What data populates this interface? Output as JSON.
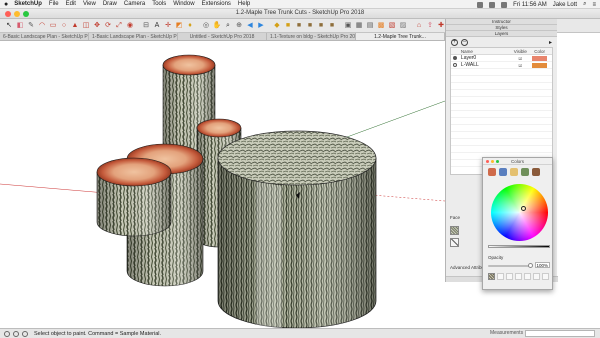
{
  "menubar": {
    "apple": "",
    "app_name": "SketchUp",
    "items": [
      "File",
      "Edit",
      "View",
      "Draw",
      "Camera",
      "Tools",
      "Window",
      "Extensions",
      "Help"
    ],
    "clock": "Fri 11:56 AM",
    "user": "Jake Lott"
  },
  "window": {
    "title": "1.2-Maple Tree Trunk Cuts - SketchUp Pro 2018",
    "traffic_lights": [
      "#ff5f57",
      "#febc2e",
      "#28c840"
    ]
  },
  "toolbar": {
    "icons": [
      {
        "name": "select-tool-icon",
        "glyph": "↖",
        "color": "#333333"
      },
      {
        "name": "eraser-tool-icon",
        "glyph": "◧",
        "color": "#d65b6e"
      },
      {
        "name": "line-tool-icon",
        "glyph": "✎",
        "color": "#555555"
      },
      {
        "name": "arc-tool-icon",
        "glyph": "◠",
        "color": "#c0392b"
      },
      {
        "name": "rectangle-tool-icon",
        "glyph": "▭",
        "color": "#c0392b"
      },
      {
        "name": "circle-tool-icon",
        "glyph": "○",
        "color": "#c0392b"
      },
      {
        "name": "push-pull-tool-icon",
        "glyph": "▲",
        "color": "#c0392b"
      },
      {
        "name": "offset-tool-icon",
        "glyph": "◫",
        "color": "#c0392b"
      },
      {
        "name": "move-tool-icon",
        "glyph": "✥",
        "color": "#c0392b"
      },
      {
        "name": "rotate-tool-icon",
        "glyph": "⟳",
        "color": "#c0392b"
      },
      {
        "name": "scale-tool-icon",
        "glyph": "⤢",
        "color": "#c0392b"
      },
      {
        "name": "follow-me-tool-icon",
        "glyph": "◉",
        "color": "#c0392b"
      },
      {
        "name": "tape-measure-tool-icon",
        "glyph": "⊟",
        "color": "#555555"
      },
      {
        "name": "text-tool-icon",
        "glyph": "A",
        "color": "#333333"
      },
      {
        "name": "axes-tool-icon",
        "glyph": "✛",
        "color": "#c0392b"
      },
      {
        "name": "section-plane-tool-icon",
        "glyph": "◩",
        "color": "#e67e22"
      },
      {
        "name": "paint-bucket-tool-icon",
        "glyph": "♦",
        "color": "#d4a017"
      },
      {
        "name": "orbit-tool-icon",
        "glyph": "◎",
        "color": "#555555"
      },
      {
        "name": "pan-tool-icon",
        "glyph": "✋",
        "color": "#555555"
      },
      {
        "name": "zoom-tool-icon",
        "glyph": "⌕",
        "color": "#333333"
      },
      {
        "name": "zoom-extents-icon",
        "glyph": "⊕",
        "color": "#555555"
      },
      {
        "name": "previous-view-icon",
        "glyph": "◀",
        "color": "#2e86de"
      },
      {
        "name": "next-view-icon",
        "glyph": "▶",
        "color": "#2e86de"
      },
      {
        "name": "iso-view-icon",
        "glyph": "◆",
        "color": "#d4a017"
      },
      {
        "name": "top-view-icon",
        "glyph": "■",
        "color": "#d4a017"
      },
      {
        "name": "front-view-icon",
        "glyph": "■",
        "color": "#8e6e3b"
      },
      {
        "name": "right-view-icon",
        "glyph": "■",
        "color": "#8e6e3b"
      },
      {
        "name": "back-view-icon",
        "glyph": "■",
        "color": "#8e6e3b"
      },
      {
        "name": "left-view-icon",
        "glyph": "■",
        "color": "#8e6e3b"
      },
      {
        "name": "xray-icon",
        "glyph": "▣",
        "color": "#555555"
      },
      {
        "name": "wireframe-icon",
        "glyph": "▦",
        "color": "#555555"
      },
      {
        "name": "hidden-line-icon",
        "glyph": "▤",
        "color": "#555555"
      },
      {
        "name": "shaded-icon",
        "glyph": "▩",
        "color": "#e67e22"
      },
      {
        "name": "shaded-textures-icon",
        "glyph": "▧",
        "color": "#c0392b"
      },
      {
        "name": "monochrome-icon",
        "glyph": "▨",
        "color": "#777777"
      },
      {
        "name": "warehouse-icon",
        "glyph": "⌂",
        "color": "#c0392b"
      },
      {
        "name": "share-model-icon",
        "glyph": "⇪",
        "color": "#d65b6e"
      },
      {
        "name": "extension-warehouse-icon",
        "glyph": "✚",
        "color": "#c0392b"
      },
      {
        "name": "layout-icon",
        "glyph": "▥",
        "color": "#2e86de"
      },
      {
        "name": "dynamic-components-icon",
        "glyph": "◐",
        "color": "#27ae60"
      },
      {
        "name": "instructor-icon",
        "glyph": "?",
        "color": "#ffffff"
      },
      {
        "name": "tray-toggle-icon",
        "glyph": "▮",
        "color": "#333333"
      }
    ]
  },
  "tabs": [
    {
      "label": "6-Basic Landscape Plan - SketchUp Pr...",
      "active": false
    },
    {
      "label": "1-Basic Landscape Plan - SketchUp Pr...",
      "active": false
    },
    {
      "label": "Untitled - SketchUp Pro 2018",
      "active": false
    },
    {
      "label": "1.1-Texture on bldg - SketchUp Pro 2018",
      "active": false
    },
    {
      "label": "1.2-Maple Tree Trunk...",
      "active": true
    }
  ],
  "tray": {
    "instructor_label": "Instructor",
    "styles_label": "Styles",
    "layers_label": "Layers",
    "add_layer_glyph": "+",
    "delete_layer_glyph": "−",
    "details_glyph": "▸",
    "columns": {
      "name": "Name",
      "visible": "Visible",
      "color": "Color"
    },
    "layers": [
      {
        "name": "Layer0",
        "active": true,
        "visible": true,
        "color": "#e8856d"
      },
      {
        "name": "L-WALL",
        "active": false,
        "visible": true,
        "color": "#e38c3b"
      }
    ],
    "face_label": "Face",
    "advanced_attributes": "Advanced Attribu..."
  },
  "colors_panel": {
    "title": "Colors",
    "modes": [
      "#cf6a4a",
      "#5a7fbf",
      "#e4c070",
      "#6f8f5a",
      "#8a5a3a"
    ],
    "opacity_label": "Opacity",
    "opacity_value": "100%",
    "opacity_fraction": 1.0,
    "swatch_count": 7
  },
  "statusbar": {
    "text": "Select object to paint. Command = Sample Material.",
    "measurements_label": "Measurements"
  },
  "scene": {
    "bark_colors": [
      "#3f4732",
      "#c9cbb9"
    ],
    "end_grain_colors": [
      "#c45a3b",
      "#e8b08c"
    ]
  }
}
